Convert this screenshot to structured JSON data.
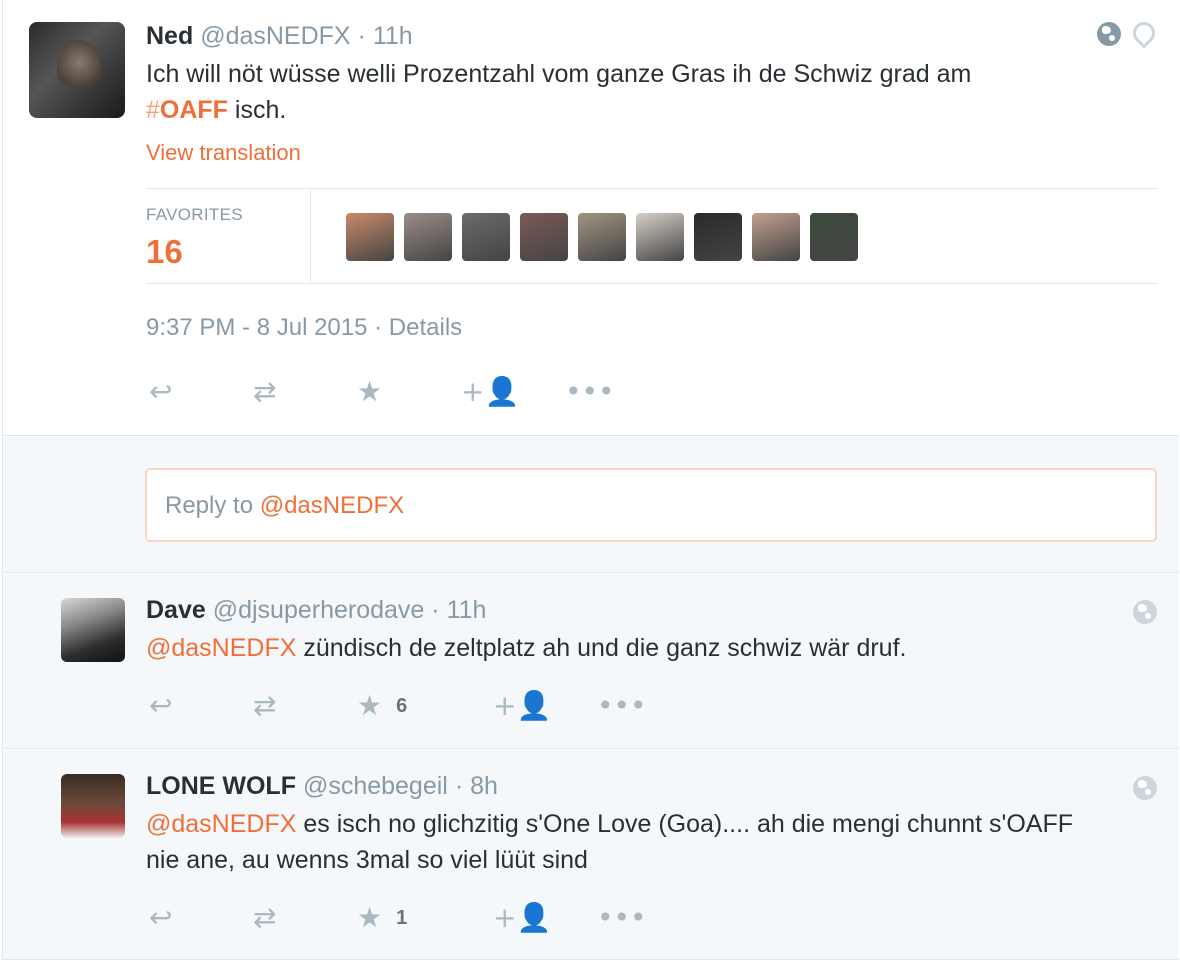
{
  "main_tweet": {
    "name": "Ned",
    "handle": "@dasNEDFX",
    "time": "11h",
    "text_before": "Ich will nöt wüsse welli Prozentzahl vom ganze Gras ih de Schwiz grad am",
    "hashtag_symbol": "#",
    "hashtag": "OAFF",
    "text_after": " isch.",
    "view_translation": "View translation",
    "favorites_label": "FAVORITES",
    "favorites_count": "16",
    "timestamp": "9:37 PM - 8 Jul 2015",
    "details": "Details",
    "favoriter_colors": [
      "#c98a6a",
      "#9b8d88",
      "#6b6b6b",
      "#7a5a55",
      "#a39480",
      "#d8d0c8",
      "#2a2a2a",
      "#c2a090",
      "#3c4a3c"
    ]
  },
  "reply_box": {
    "placeholder": "Reply to ",
    "mention": "@dasNEDFX"
  },
  "replies": [
    {
      "name": "Dave",
      "handle": "@djsuperherodave",
      "time": "11h",
      "mention": "@dasNEDFX",
      "text": " zündisch de zeltplatz ah und die ganz schwiz wär druf.",
      "favorite_count": "6"
    },
    {
      "name": "LONE WOLF",
      "handle": "@schebegeil",
      "time": "8h",
      "mention": "@dasNEDFX",
      "text": " es isch no glichzitig s'One Love (Goa).... ah die mengi chunnt s'OAFF nie ane, au wenns 3mal so viel lüüt sind",
      "favorite_count": "1"
    }
  ],
  "separator": " · ",
  "icons": {
    "reply": "reply-icon",
    "retweet": "retweet-icon",
    "favorite": "star-icon",
    "follow": "follow-icon",
    "more": "more-icon",
    "globe": "globe-icon",
    "location": "location-pin-icon"
  },
  "colors": {
    "accent": "#f06f39",
    "muted": "#8899a6",
    "icon": "#aab8c2",
    "background": "#f5f8fa"
  }
}
